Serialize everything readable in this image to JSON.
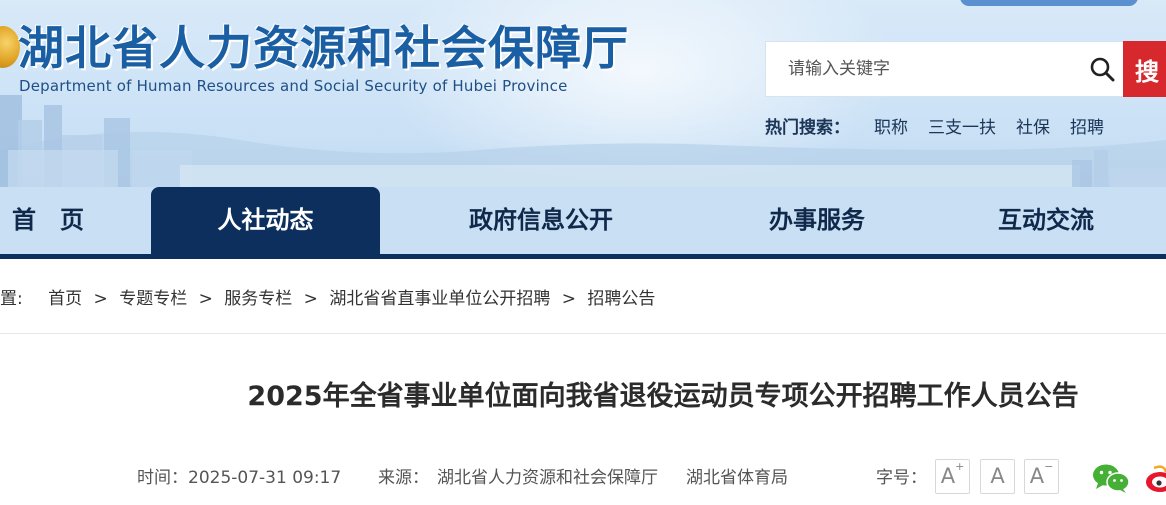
{
  "header": {
    "title": "湖北省人力资源和社会保障厅",
    "subtitle": "Department of Human Resources and Social Security of Hubei Province",
    "search": {
      "placeholder": "请输入关键字",
      "button": "搜"
    },
    "hot_search": {
      "label": "热门搜索：",
      "items": [
        "职称",
        "三支一扶",
        "社保",
        "招聘"
      ]
    }
  },
  "nav": {
    "items": [
      "首　页",
      "人社动态",
      "政府信息公开",
      "办事服务",
      "互动交流"
    ],
    "active": "人社动态"
  },
  "breadcrumb": {
    "prefix": "置:",
    "items": [
      "首页",
      "专题专栏",
      "服务专栏",
      "湖北省省直事业单位公开招聘",
      "招聘公告"
    ],
    "separator": ">"
  },
  "article": {
    "title": "2025年全省事业单位面向我省退役运动员专项公开招聘工作人员公告",
    "time_label": "时间：",
    "time": "2025-07-31 09:17",
    "source_label": "来源：",
    "source_1": "湖北省人力资源和社会保障厅",
    "source_2": "湖北省体育局",
    "font_size_label": "字号：",
    "font_buttons": [
      "A",
      "A",
      "A"
    ]
  },
  "colors": {
    "nav_active": "#0d2f5e",
    "search_button": "#d7282d",
    "title_blue": "#1a5fa3"
  },
  "icons": {
    "search": "search-icon",
    "wechat": "wechat-icon",
    "weibo": "weibo-icon"
  }
}
